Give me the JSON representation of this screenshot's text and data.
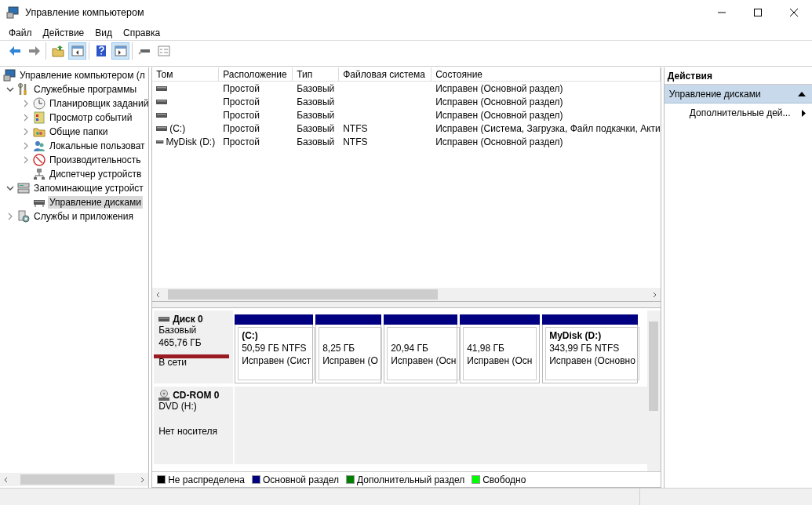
{
  "window": {
    "title": "Управление компьютером"
  },
  "menu": [
    "Файл",
    "Действие",
    "Вид",
    "Справка"
  ],
  "toolbar": [
    [
      {
        "kind": "back",
        "pressed": false
      },
      {
        "kind": "forward",
        "pressed": false
      }
    ],
    [
      {
        "kind": "up-folder",
        "pressed": false
      },
      {
        "kind": "console-tree",
        "pressed": true
      }
    ],
    [
      {
        "kind": "help",
        "pressed": false
      },
      {
        "kind": "action-pane",
        "pressed": true
      }
    ],
    [
      {
        "kind": "connect",
        "pressed": false
      },
      {
        "kind": "properties",
        "pressed": false
      }
    ]
  ],
  "tree": [
    {
      "label": "Управление компьютером (л",
      "kind": "computer",
      "selected": false,
      "children": [
        {
          "label": "Служебные программы",
          "kind": "tools",
          "expanded": true,
          "selected": false,
          "children": [
            {
              "label": "Планировщик заданий",
              "kind": "clock",
              "expanded": false,
              "selected": false
            },
            {
              "label": "Просмотр событий",
              "kind": "events",
              "expanded": false,
              "selected": false
            },
            {
              "label": "Общие папки",
              "kind": "folder",
              "expanded": false,
              "selected": false
            },
            {
              "label": "Локальные пользоват",
              "kind": "users",
              "expanded": false,
              "selected": false
            },
            {
              "label": "Производительность",
              "kind": "gauge",
              "expanded": false,
              "selected": false
            },
            {
              "label": "Диспетчер устройств",
              "kind": "devices",
              "selected": false
            }
          ]
        },
        {
          "label": "Запоминающие устройст",
          "kind": "storage",
          "expanded": true,
          "selected": false,
          "children": [
            {
              "label": "Управление дисками",
              "kind": "disk",
              "selected": true
            }
          ]
        },
        {
          "label": "Службы и приложения",
          "kind": "services",
          "expanded": false,
          "selected": false
        }
      ]
    }
  ],
  "volumes": {
    "columns": [
      "Том",
      "Расположение",
      "Тип",
      "Файловая система",
      "Состояние"
    ],
    "rows": [
      [
        "",
        "Простой",
        "Базовый",
        "",
        "Исправен (Основной раздел)"
      ],
      [
        "",
        "Простой",
        "Базовый",
        "",
        "Исправен (Основной раздел)"
      ],
      [
        "",
        "Простой",
        "Базовый",
        "",
        "Исправен (Основной раздел)"
      ],
      [
        "(C:)",
        "Простой",
        "Базовый",
        "NTFS",
        "Исправен (Система, Загрузка, Файл подкачки, Акти"
      ],
      [
        "MyDisk (D:)",
        "Простой",
        "Базовый",
        "NTFS",
        "Исправен (Основной раздел)"
      ]
    ]
  },
  "disks": [
    {
      "name": "Диск 0",
      "kind": "disk",
      "lines": [
        "Базовый",
        "465,76 ГБ"
      ],
      "status": "В сети",
      "partitions": [
        {
          "title": "(C:)",
          "size": "50,59 ГБ NTFS",
          "status": "Исправен (Сист",
          "color": "#000080"
        },
        {
          "size": "8,25 ГБ",
          "status": "Исправен (О",
          "color": "#000080"
        },
        {
          "size": "20,94 ГБ",
          "status": "Исправен (Осн",
          "color": "#000080"
        },
        {
          "size": "41,98 ГБ",
          "status": "Исправен (Осн",
          "color": "#000080"
        },
        {
          "title": "MyDisk  (D:)",
          "size": "343,99 ГБ NTFS",
          "status": "Исправен (Основно",
          "color": "#000080"
        }
      ]
    },
    {
      "name": "CD-ROM 0",
      "kind": "cdrom",
      "lines": [
        "DVD (H:)"
      ],
      "status": "Нет носителя"
    }
  ],
  "legend": [
    {
      "label": "Не распределена",
      "color": "#000000"
    },
    {
      "label": "Основной раздел",
      "color": "#000080"
    },
    {
      "label": "Дополнительный раздел",
      "color": "#008000"
    },
    {
      "label": "Свободно",
      "color": "#00ff00"
    }
  ],
  "actions": {
    "header": "Действия",
    "sections": [
      {
        "title": "Управление дисками",
        "expanded": true,
        "items": [
          "Дополнительные дей..."
        ]
      }
    ]
  }
}
